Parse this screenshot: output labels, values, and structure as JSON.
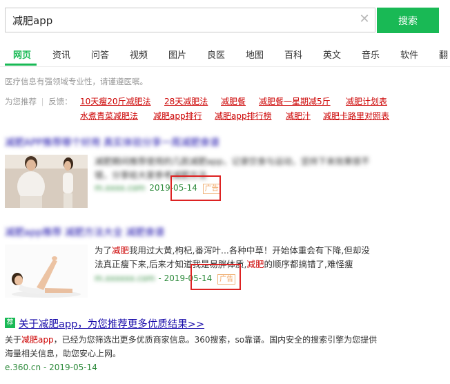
{
  "search": {
    "query": "减肥app",
    "button_label": "搜索"
  },
  "tabs": [
    "网页",
    "资讯",
    "问答",
    "视频",
    "图片",
    "良医",
    "地图",
    "百科",
    "英文",
    "音乐",
    "软件",
    "翻"
  ],
  "notice": "医疗信息有强领域专业性，请谨遵医嘱。",
  "recommend": {
    "label": "为您推荐",
    "separator": "|",
    "feedback": "反馈：",
    "links": [
      "10天瘦20斤减肥法",
      "28天减肥法",
      "减肥餐",
      "减肥餐一星期减5斤",
      "减肥计划表",
      "水煮青菜减肥法",
      "减肥app排行",
      "减肥app排行榜",
      "减肥汁",
      "减肥卡路里对照表"
    ]
  },
  "results": [
    {
      "title": "减肥APP推荐哪个好用 真实体验分享一周减肥食谱",
      "snippet": "减肥期间推荐使用的几款减肥app，记录饮食与运动，坚持下来效果很不错，分享给大家参考减肥方法",
      "source": "m.xxxx.com",
      "date": "2019-05-14",
      "ad_label": "广告"
    },
    {
      "title": "减肥app推荐 减肥方法大全 减肥食谱",
      "snippet_pre": "为了",
      "snippet_hl1": "减肥",
      "snippet_mid": "我用过大黄,枸杞,番泻叶...各种中草！开始体重会有下降,但却没法真正瘦下来,后来才知道我是易胖体质,",
      "snippet_hl2": "减肥",
      "snippet_post": "的顺序都搞错了,难怪瘦",
      "source": "m.xxxxxx.com",
      "date": "2019-05-14",
      "ad_label": "广告"
    }
  ],
  "bottom": {
    "badge": "荐",
    "title": "关于减肥app，为您推荐更多优质结果>>",
    "desc_pre": "关于",
    "desc_hl": "减肥app",
    "desc_post": "，已经为您筛选出更多优质商家信息。360搜索，so靠谱。国内安全的搜索引擎为您提供海量相关信息，助您安心上网。",
    "source": "e.360.cn",
    "date": "2019-05-14"
  },
  "colors": {
    "accent": "#19b955",
    "link": "#1a0dab",
    "highlight": "#cc0000",
    "url": "#2d8a3b"
  }
}
